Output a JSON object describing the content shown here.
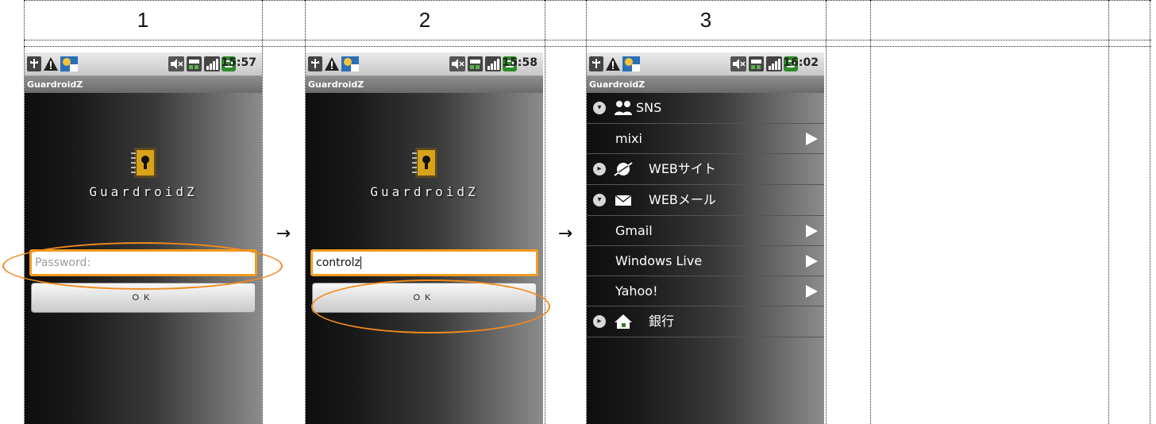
{
  "columns": {
    "c1": "1",
    "c2": "2",
    "c3": "3"
  },
  "arrows": {
    "a1": "→",
    "a2": "→"
  },
  "status": {
    "time1": "15:57",
    "time2": "15:58",
    "time3": "16:02"
  },
  "app_title": "GuardroidZ",
  "logo_text": "GuardroidZ",
  "screen1": {
    "password_placeholder": "Password:",
    "ok_label": "OK"
  },
  "screen2": {
    "password_value": "controlz",
    "ok_label": "OK"
  },
  "screen3": {
    "groups": [
      {
        "label": "SNS",
        "expanded": true,
        "icon": "people-icon",
        "children": [
          "mixi"
        ]
      },
      {
        "label": "WEBサイト",
        "expanded": false,
        "icon": "globe-icon",
        "children": []
      },
      {
        "label": "WEBメール",
        "expanded": true,
        "icon": "envelope-icon",
        "children": [
          "Gmail",
          "Windows Live",
          "Yahoo!"
        ]
      },
      {
        "label": "銀行",
        "expanded": false,
        "icon": "bank-icon",
        "children": []
      }
    ]
  },
  "colors": {
    "highlight": "#f08a1c",
    "field_focus": "#f39c1f"
  }
}
